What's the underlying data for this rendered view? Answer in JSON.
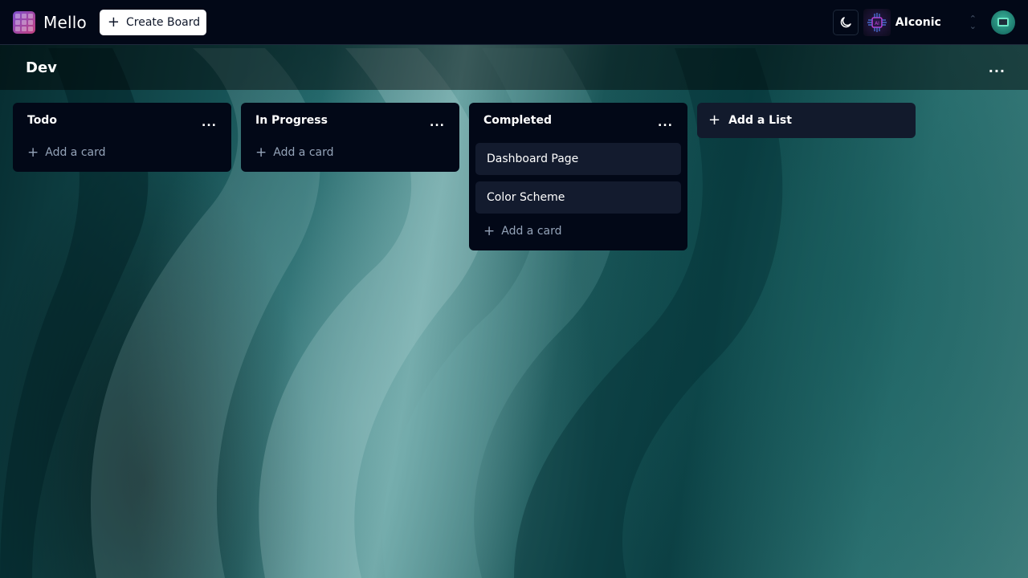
{
  "app": {
    "name": "Mello",
    "create_board_label": "Create Board"
  },
  "org": {
    "name": "AIconic"
  },
  "board": {
    "title": "Dev",
    "menu_label": "...",
    "lists": [
      {
        "title": "Todo",
        "menu_label": "...",
        "cards": [],
        "add_card_label": "Add a card"
      },
      {
        "title": "In Progress",
        "menu_label": "...",
        "cards": [],
        "add_card_label": "Add a card"
      },
      {
        "title": "Completed",
        "menu_label": "...",
        "cards": [
          "Dashboard Page",
          "Color Scheme"
        ],
        "add_card_label": "Add a card"
      }
    ],
    "add_list_label": "Add a List"
  },
  "icons": {
    "logo": "board-grid-icon",
    "create": "plus-icon",
    "theme": "moon-icon",
    "switcher": "chevrons-up-down-icon",
    "user": "avatar-icon"
  },
  "colors": {
    "navbar_bg": "#020817",
    "list_bg": "#020817",
    "card_bg": "#131b2e",
    "muted_text": "#94a3b8"
  }
}
